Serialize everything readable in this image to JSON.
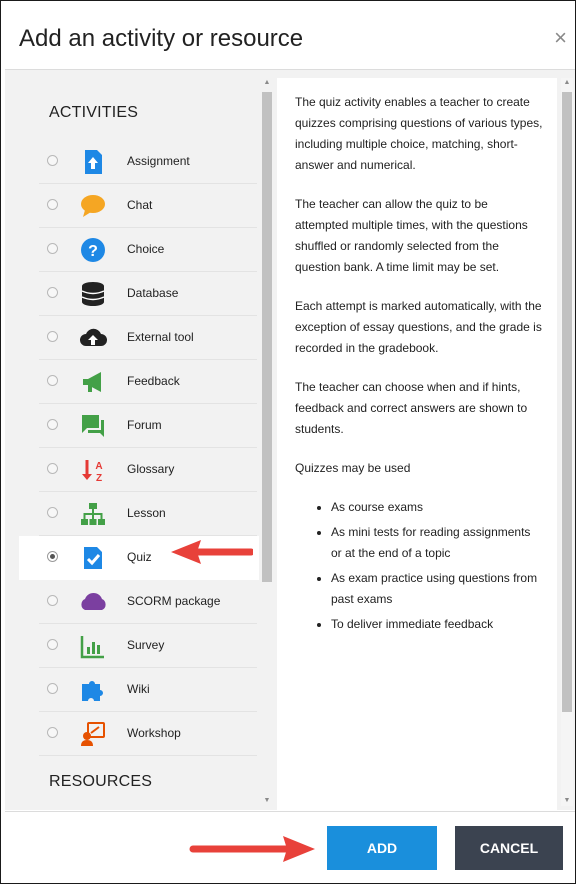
{
  "dialog": {
    "title": "Add an activity or resource",
    "close_icon": "×"
  },
  "activities_heading": "ACTIVITIES",
  "resources_heading": "RESOURCES",
  "activities": [
    {
      "label": "Assignment",
      "icon": "assignment-icon",
      "selected": false
    },
    {
      "label": "Chat",
      "icon": "chat-icon",
      "selected": false
    },
    {
      "label": "Choice",
      "icon": "choice-icon",
      "selected": false
    },
    {
      "label": "Database",
      "icon": "database-icon",
      "selected": false
    },
    {
      "label": "External tool",
      "icon": "external-tool-icon",
      "selected": false
    },
    {
      "label": "Feedback",
      "icon": "feedback-icon",
      "selected": false
    },
    {
      "label": "Forum",
      "icon": "forum-icon",
      "selected": false
    },
    {
      "label": "Glossary",
      "icon": "glossary-icon",
      "selected": false
    },
    {
      "label": "Lesson",
      "icon": "lesson-icon",
      "selected": false
    },
    {
      "label": "Quiz",
      "icon": "quiz-icon",
      "selected": true
    },
    {
      "label": "SCORM package",
      "icon": "scorm-icon",
      "selected": false
    },
    {
      "label": "Survey",
      "icon": "survey-icon",
      "selected": false
    },
    {
      "label": "Wiki",
      "icon": "wiki-icon",
      "selected": false
    },
    {
      "label": "Workshop",
      "icon": "workshop-icon",
      "selected": false
    }
  ],
  "description": {
    "paragraphs": [
      "The quiz activity enables a teacher to create quizzes comprising questions of various types, including multiple choice, matching, short-answer and numerical.",
      "The teacher can allow the quiz to be attempted multiple times, with the questions shuffled or randomly selected from the question bank. A time limit may be set.",
      "Each attempt is marked automatically, with the exception of essay questions, and the grade is recorded in the gradebook.",
      "The teacher can choose when and if hints, feedback and correct answers are shown to students.",
      "Quizzes may be used"
    ],
    "bullets": [
      "As course exams",
      "As mini tests for reading assignments or at the end of a topic",
      "As exam practice using questions from past exams",
      "To deliver immediate feedback"
    ]
  },
  "footer": {
    "add_label": "ADD",
    "cancel_label": "CANCEL"
  },
  "colors": {
    "add_button": "#1a8fdc",
    "cancel_button": "#3b4350",
    "annotation_arrow": "#e8413a"
  }
}
